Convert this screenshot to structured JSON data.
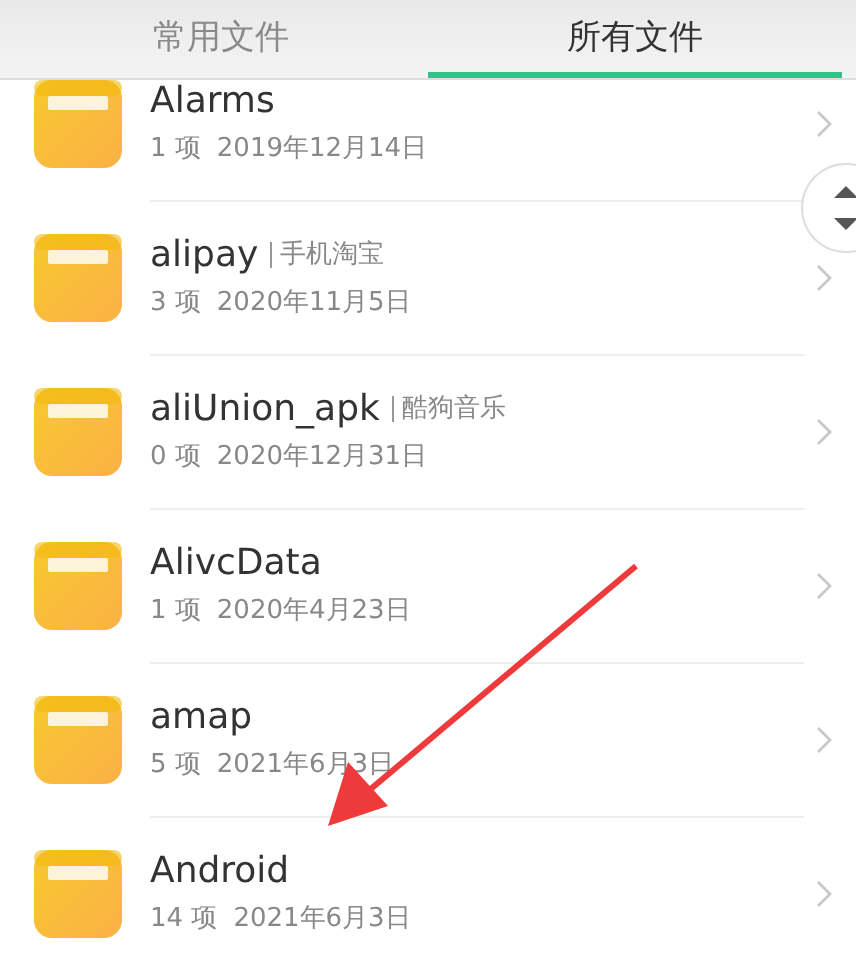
{
  "tabs": [
    {
      "label": "常用文件",
      "selected": false
    },
    {
      "label": "所有文件",
      "selected": true
    }
  ],
  "files": [
    {
      "name": "Alarms",
      "count": "1 项",
      "date": "2019年12月14日"
    },
    {
      "name": "alipay",
      "app": "手机淘宝",
      "count": "3 项",
      "date": "2020年11月5日"
    },
    {
      "name": "aliUnion_apk",
      "app": "酷狗音乐",
      "count": "0 项",
      "date": "2020年12月31日"
    },
    {
      "name": "AlivcData",
      "count": "1 项",
      "date": "2020年4月23日"
    },
    {
      "name": "amap",
      "count": "5 项",
      "date": "2021年6月3日"
    },
    {
      "name": "Android",
      "count": "14 项",
      "date": "2021年6月3日"
    }
  ]
}
